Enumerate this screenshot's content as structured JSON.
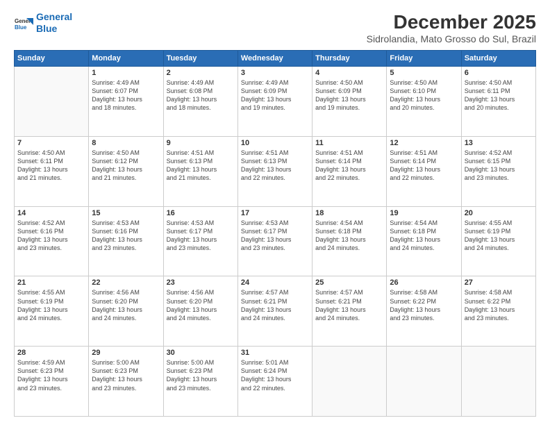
{
  "logo": {
    "line1": "General",
    "line2": "Blue"
  },
  "title": "December 2025",
  "subtitle": "Sidrolandia, Mato Grosso do Sul, Brazil",
  "weekdays": [
    "Sunday",
    "Monday",
    "Tuesday",
    "Wednesday",
    "Thursday",
    "Friday",
    "Saturday"
  ],
  "weeks": [
    [
      {
        "day": "",
        "info": ""
      },
      {
        "day": "1",
        "info": "Sunrise: 4:49 AM\nSunset: 6:07 PM\nDaylight: 13 hours\nand 18 minutes."
      },
      {
        "day": "2",
        "info": "Sunrise: 4:49 AM\nSunset: 6:08 PM\nDaylight: 13 hours\nand 18 minutes."
      },
      {
        "day": "3",
        "info": "Sunrise: 4:49 AM\nSunset: 6:09 PM\nDaylight: 13 hours\nand 19 minutes."
      },
      {
        "day": "4",
        "info": "Sunrise: 4:50 AM\nSunset: 6:09 PM\nDaylight: 13 hours\nand 19 minutes."
      },
      {
        "day": "5",
        "info": "Sunrise: 4:50 AM\nSunset: 6:10 PM\nDaylight: 13 hours\nand 20 minutes."
      },
      {
        "day": "6",
        "info": "Sunrise: 4:50 AM\nSunset: 6:11 PM\nDaylight: 13 hours\nand 20 minutes."
      }
    ],
    [
      {
        "day": "7",
        "info": "Sunrise: 4:50 AM\nSunset: 6:11 PM\nDaylight: 13 hours\nand 21 minutes."
      },
      {
        "day": "8",
        "info": "Sunrise: 4:50 AM\nSunset: 6:12 PM\nDaylight: 13 hours\nand 21 minutes."
      },
      {
        "day": "9",
        "info": "Sunrise: 4:51 AM\nSunset: 6:13 PM\nDaylight: 13 hours\nand 21 minutes."
      },
      {
        "day": "10",
        "info": "Sunrise: 4:51 AM\nSunset: 6:13 PM\nDaylight: 13 hours\nand 22 minutes."
      },
      {
        "day": "11",
        "info": "Sunrise: 4:51 AM\nSunset: 6:14 PM\nDaylight: 13 hours\nand 22 minutes."
      },
      {
        "day": "12",
        "info": "Sunrise: 4:51 AM\nSunset: 6:14 PM\nDaylight: 13 hours\nand 22 minutes."
      },
      {
        "day": "13",
        "info": "Sunrise: 4:52 AM\nSunset: 6:15 PM\nDaylight: 13 hours\nand 23 minutes."
      }
    ],
    [
      {
        "day": "14",
        "info": "Sunrise: 4:52 AM\nSunset: 6:16 PM\nDaylight: 13 hours\nand 23 minutes."
      },
      {
        "day": "15",
        "info": "Sunrise: 4:53 AM\nSunset: 6:16 PM\nDaylight: 13 hours\nand 23 minutes."
      },
      {
        "day": "16",
        "info": "Sunrise: 4:53 AM\nSunset: 6:17 PM\nDaylight: 13 hours\nand 23 minutes."
      },
      {
        "day": "17",
        "info": "Sunrise: 4:53 AM\nSunset: 6:17 PM\nDaylight: 13 hours\nand 23 minutes."
      },
      {
        "day": "18",
        "info": "Sunrise: 4:54 AM\nSunset: 6:18 PM\nDaylight: 13 hours\nand 24 minutes."
      },
      {
        "day": "19",
        "info": "Sunrise: 4:54 AM\nSunset: 6:18 PM\nDaylight: 13 hours\nand 24 minutes."
      },
      {
        "day": "20",
        "info": "Sunrise: 4:55 AM\nSunset: 6:19 PM\nDaylight: 13 hours\nand 24 minutes."
      }
    ],
    [
      {
        "day": "21",
        "info": "Sunrise: 4:55 AM\nSunset: 6:19 PM\nDaylight: 13 hours\nand 24 minutes."
      },
      {
        "day": "22",
        "info": "Sunrise: 4:56 AM\nSunset: 6:20 PM\nDaylight: 13 hours\nand 24 minutes."
      },
      {
        "day": "23",
        "info": "Sunrise: 4:56 AM\nSunset: 6:20 PM\nDaylight: 13 hours\nand 24 minutes."
      },
      {
        "day": "24",
        "info": "Sunrise: 4:57 AM\nSunset: 6:21 PM\nDaylight: 13 hours\nand 24 minutes."
      },
      {
        "day": "25",
        "info": "Sunrise: 4:57 AM\nSunset: 6:21 PM\nDaylight: 13 hours\nand 24 minutes."
      },
      {
        "day": "26",
        "info": "Sunrise: 4:58 AM\nSunset: 6:22 PM\nDaylight: 13 hours\nand 23 minutes."
      },
      {
        "day": "27",
        "info": "Sunrise: 4:58 AM\nSunset: 6:22 PM\nDaylight: 13 hours\nand 23 minutes."
      }
    ],
    [
      {
        "day": "28",
        "info": "Sunrise: 4:59 AM\nSunset: 6:23 PM\nDaylight: 13 hours\nand 23 minutes."
      },
      {
        "day": "29",
        "info": "Sunrise: 5:00 AM\nSunset: 6:23 PM\nDaylight: 13 hours\nand 23 minutes."
      },
      {
        "day": "30",
        "info": "Sunrise: 5:00 AM\nSunset: 6:23 PM\nDaylight: 13 hours\nand 23 minutes."
      },
      {
        "day": "31",
        "info": "Sunrise: 5:01 AM\nSunset: 6:24 PM\nDaylight: 13 hours\nand 22 minutes."
      },
      {
        "day": "",
        "info": ""
      },
      {
        "day": "",
        "info": ""
      },
      {
        "day": "",
        "info": ""
      }
    ]
  ]
}
